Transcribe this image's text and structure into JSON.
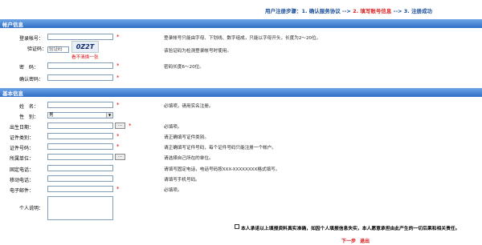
{
  "steps": {
    "prefix": "用户注册步骤：",
    "s1": "1. 确认服务协议 -->",
    "s2": "2. 填写账号信息",
    "s3": "--> 3. 注册成功"
  },
  "account": {
    "title": "帐户信息",
    "login_label": "登录帐号：",
    "login_hint": "登录帐号只能由字母、下划线、数字组成，只能以字母开头，长度为2～20位。",
    "code_label": "验证码：",
    "code_img": "0Z2T",
    "code_placeholder": "验证码",
    "code_refresh": "看不清换一张",
    "code_hint": "该验证码为检测登录帐号时使用。",
    "pwd_label": "密　码：",
    "pwd_hint": "密码长度6～20位。",
    "pwd2_label": "确认密码："
  },
  "basic": {
    "title": "基本信息",
    "name_label": "姓　名：",
    "name_hint": "必填项，请用实名注册。",
    "gender_label": "性　别：",
    "gender_value": "男",
    "birth_label": "出生日期：",
    "birth_hint": "必填项。",
    "idtype_label": "证件类别：",
    "idtype_hint": "请正确填写证件类别。",
    "idno_label": "证件号码：",
    "idno_hint": "请正确填写证件号码，每个证件号码只能注册一个帐户。",
    "unit_label": "所属单位：",
    "unit_hint": "请选择自己所在的单位。",
    "tel_label": "固定电话：",
    "tel_hint": "请填写固定电话，电话号码按XXX-XXXXXXXX格式填写。",
    "mobile_label": "移动电话：",
    "mobile_hint": "请填写手机号码。",
    "email_label": "电子邮件：",
    "email_hint": "必填项。",
    "note_label": "个人说明：",
    "browse": "…"
  },
  "agree_text": "本人承诺以上填报资料真实准确，如因个人填报信息失实，本人愿意承担由此产生的一切后果和相关责任。",
  "next_btn": "下一步",
  "exit_btn": "退出",
  "required_mark": "*"
}
